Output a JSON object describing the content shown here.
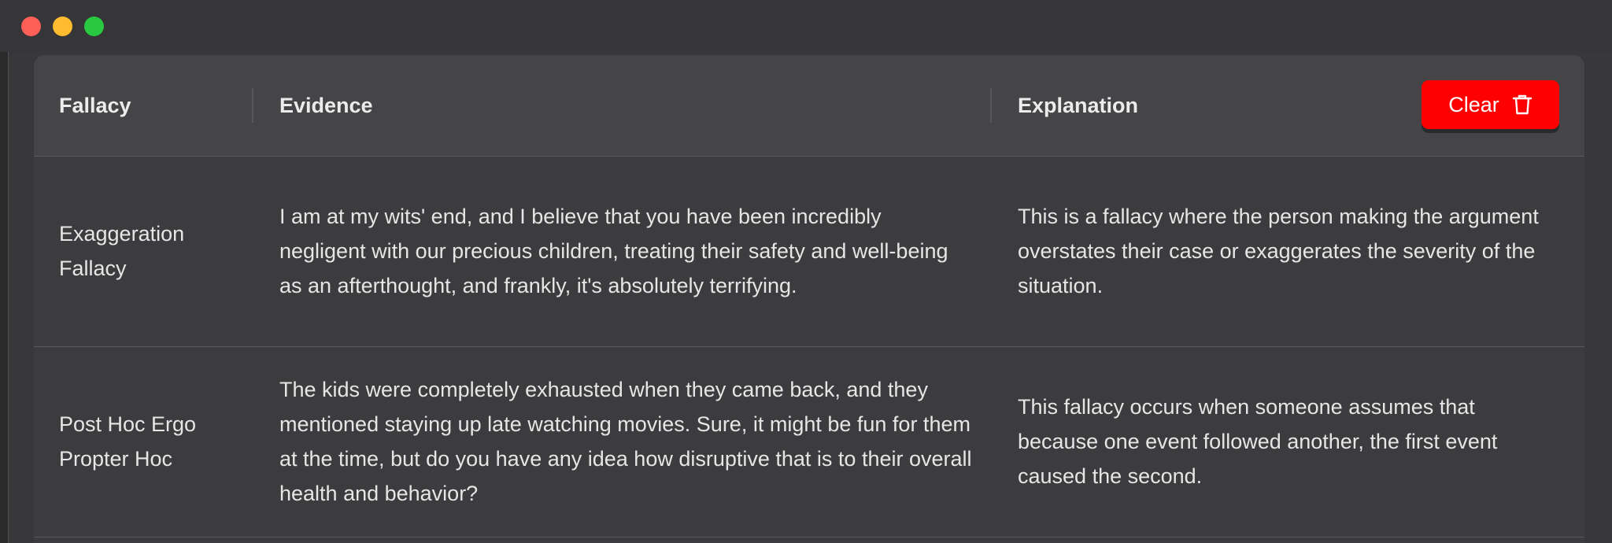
{
  "window": {
    "controls": [
      "close",
      "minimize",
      "maximize"
    ]
  },
  "table": {
    "headers": {
      "fallacy": "Fallacy",
      "evidence": "Evidence",
      "explanation": "Explanation"
    },
    "clear_button": {
      "label": "Clear",
      "icon": "trash-icon",
      "color": "#ff0000"
    },
    "rows": [
      {
        "fallacy": "Exaggeration Fallacy",
        "evidence": "I am at my wits' end, and I believe that you have been incredibly negligent with our precious children, treating their safety and well-being as an afterthought, and frankly, it's absolutely terrifying.",
        "explanation": "This is a fallacy where the person making the argument overstates their case or exaggerates the severity of the situation."
      },
      {
        "fallacy": "Post Hoc Ergo Propter Hoc",
        "evidence": "The kids were completely exhausted when they came back, and they mentioned staying up late watching movies. Sure, it might be fun for them at the time, but do you have any idea how disruptive that is to their overall health and behavior?",
        "explanation": "This fallacy occurs when someone assumes that because one event followed another, the first event caused the second."
      }
    ]
  }
}
